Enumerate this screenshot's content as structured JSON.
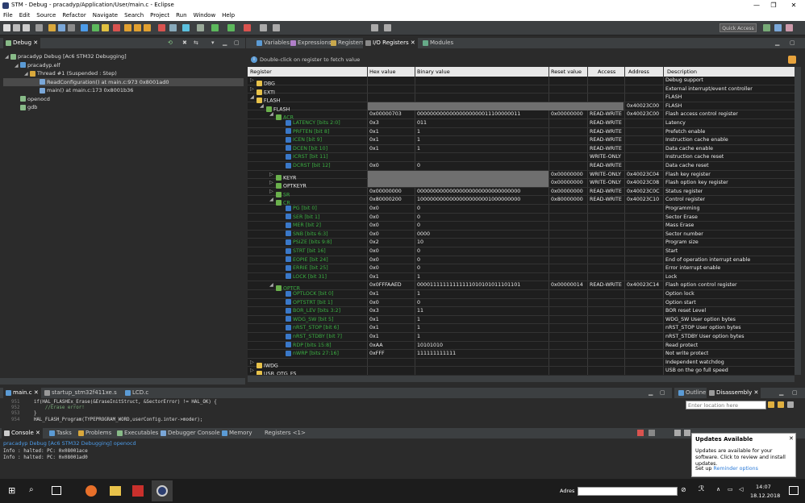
{
  "window": {
    "title": "STM - Debug - pracadyp/Application/User/main.c - Eclipse",
    "minimize": "—",
    "maximize": "❐",
    "close": "✕"
  },
  "menu": [
    "File",
    "Edit",
    "Source",
    "Refactor",
    "Navigate",
    "Search",
    "Project",
    "Run",
    "Window",
    "Help"
  ],
  "toolbar": {
    "quick_access": "Quick Access"
  },
  "debug": {
    "tab": "Debug",
    "tree": [
      {
        "label": "pracadyp Debug [Ac6 STM32 Debugging]",
        "indent": 0
      },
      {
        "label": "pracadyp.elf",
        "indent": 1
      },
      {
        "label": "Thread #1 (Suspended : Step)",
        "indent": 2
      },
      {
        "label": "ReadConfiguration() at main.c:973 0x8001ad0",
        "indent": 3
      },
      {
        "label": "main() at main.c:173 0x8001b36",
        "indent": 3
      },
      {
        "label": "openocd",
        "indent": 1
      },
      {
        "label": "gdb",
        "indent": 1
      }
    ]
  },
  "io": {
    "tabs": [
      "Variables",
      "Expressions",
      "Registers",
      "I/O Registers",
      "Modules"
    ],
    "hint": "Double-click on register to fetch value",
    "columns": [
      "Register",
      "Hex value",
      "Binary value",
      "Reset value",
      "Access",
      "Address",
      "Description"
    ],
    "rows": [
      {
        "lvl": 0,
        "tw": "▷",
        "name": "DBG",
        "hex": "",
        "bin": "",
        "reset": "",
        "access": "",
        "addr": "",
        "desc": "Debug support",
        "kind": "folder"
      },
      {
        "lvl": 0,
        "tw": "▷",
        "name": "EXTI",
        "hex": "",
        "bin": "",
        "reset": "",
        "access": "",
        "addr": "",
        "desc": "External interrupt/event controller",
        "kind": "folder"
      },
      {
        "lvl": 0,
        "tw": "◢",
        "name": "FLASH",
        "hex": "",
        "bin": "",
        "reset": "",
        "access": "",
        "addr": "",
        "desc": "FLASH",
        "kind": "folder"
      },
      {
        "lvl": 1,
        "tw": "◢",
        "name": "FLASH",
        "hex": "",
        "bin": "",
        "reset": "",
        "access": "",
        "addr": "0x40023C00",
        "desc": "FLASH",
        "kind": "periph",
        "gray": true
      },
      {
        "lvl": 2,
        "tw": "◢",
        "name": "ACR",
        "hex": "0x00000703",
        "bin": "00000000000000000000011100000011",
        "reset": "0x00000000",
        "access": "READ-WRITE",
        "addr": "0x40023C00",
        "desc": "Flash access control register",
        "kind": "reg",
        "green": true
      },
      {
        "lvl": 3,
        "tw": "",
        "name": "LATENCY [bits 2:0]",
        "hex": "0x3",
        "bin": "011",
        "reset": "",
        "access": "READ-WRITE",
        "addr": "",
        "desc": "Latency",
        "kind": "field"
      },
      {
        "lvl": 3,
        "tw": "",
        "name": "PRFTEN [bit 8]",
        "hex": "0x1",
        "bin": "1",
        "reset": "",
        "access": "READ-WRITE",
        "addr": "",
        "desc": "Prefetch enable",
        "kind": "field"
      },
      {
        "lvl": 3,
        "tw": "",
        "name": "ICEN [bit 9]",
        "hex": "0x1",
        "bin": "1",
        "reset": "",
        "access": "READ-WRITE",
        "addr": "",
        "desc": "Instruction cache enable",
        "kind": "field"
      },
      {
        "lvl": 3,
        "tw": "",
        "name": "DCEN [bit 10]",
        "hex": "0x1",
        "bin": "1",
        "reset": "",
        "access": "READ-WRITE",
        "addr": "",
        "desc": "Data cache enable",
        "kind": "field"
      },
      {
        "lvl": 3,
        "tw": "",
        "name": "ICRST [bit 11]",
        "hex": "",
        "bin": "",
        "reset": "",
        "access": "WRITE-ONLY",
        "addr": "",
        "desc": "Instruction cache reset",
        "kind": "field"
      },
      {
        "lvl": 3,
        "tw": "",
        "name": "DCRST [bit 12]",
        "hex": "0x0",
        "bin": "0",
        "reset": "",
        "access": "READ-WRITE",
        "addr": "",
        "desc": "Data cache reset",
        "kind": "field"
      },
      {
        "lvl": 2,
        "tw": "▷",
        "name": "KEYR",
        "hex": "",
        "bin": "",
        "reset": "0x00000000",
        "access": "WRITE-ONLY",
        "addr": "0x40023C04",
        "desc": "Flash key register",
        "kind": "reg",
        "gray": true
      },
      {
        "lvl": 2,
        "tw": "▷",
        "name": "OPTKEYR",
        "hex": "",
        "bin": "",
        "reset": "0x00000000",
        "access": "WRITE-ONLY",
        "addr": "0x40023C08",
        "desc": "Flash option key register",
        "kind": "reg",
        "gray": true
      },
      {
        "lvl": 2,
        "tw": "▷",
        "name": "SR",
        "hex": "0x00000000",
        "bin": "00000000000000000000000000000000",
        "reset": "0x00000000",
        "access": "READ-WRITE",
        "addr": "0x40023C0C",
        "desc": "Status register",
        "kind": "reg",
        "green": true
      },
      {
        "lvl": 2,
        "tw": "◢",
        "name": "CR",
        "hex": "0x80000200",
        "bin": "10000000000000000000001000000000",
        "reset": "0x80000000",
        "access": "READ-WRITE",
        "addr": "0x40023C10",
        "desc": "Control register",
        "kind": "reg",
        "green": true
      },
      {
        "lvl": 3,
        "tw": "",
        "name": "PG [bit 0]",
        "hex": "0x0",
        "bin": "0",
        "reset": "",
        "access": "",
        "addr": "",
        "desc": "Programming",
        "kind": "field"
      },
      {
        "lvl": 3,
        "tw": "",
        "name": "SER [bit 1]",
        "hex": "0x0",
        "bin": "0",
        "reset": "",
        "access": "",
        "addr": "",
        "desc": "Sector Erase",
        "kind": "field"
      },
      {
        "lvl": 3,
        "tw": "",
        "name": "MER [bit 2]",
        "hex": "0x0",
        "bin": "0",
        "reset": "",
        "access": "",
        "addr": "",
        "desc": "Mass Erase",
        "kind": "field"
      },
      {
        "lvl": 3,
        "tw": "",
        "name": "SNB [bits 6:3]",
        "hex": "0x0",
        "bin": "0000",
        "reset": "",
        "access": "",
        "addr": "",
        "desc": "Sector number",
        "kind": "field"
      },
      {
        "lvl": 3,
        "tw": "",
        "name": "PSIZE [bits 9:8]",
        "hex": "0x2",
        "bin": "10",
        "reset": "",
        "access": "",
        "addr": "",
        "desc": "Program size",
        "kind": "field"
      },
      {
        "lvl": 3,
        "tw": "",
        "name": "STRT [bit 16]",
        "hex": "0x0",
        "bin": "0",
        "reset": "",
        "access": "",
        "addr": "",
        "desc": "Start",
        "kind": "field"
      },
      {
        "lvl": 3,
        "tw": "",
        "name": "EOPIE [bit 24]",
        "hex": "0x0",
        "bin": "0",
        "reset": "",
        "access": "",
        "addr": "",
        "desc": "End of operation interrupt enable",
        "kind": "field"
      },
      {
        "lvl": 3,
        "tw": "",
        "name": "ERRIE [bit 25]",
        "hex": "0x0",
        "bin": "0",
        "reset": "",
        "access": "",
        "addr": "",
        "desc": "Error interrupt enable",
        "kind": "field"
      },
      {
        "lvl": 3,
        "tw": "",
        "name": "LOCK [bit 31]",
        "hex": "0x1",
        "bin": "1",
        "reset": "",
        "access": "",
        "addr": "",
        "desc": "Lock",
        "kind": "field"
      },
      {
        "lvl": 2,
        "tw": "◢",
        "name": "OPTCR",
        "hex": "0x0FFFAAED",
        "bin": "00001111111111111010101011101101",
        "reset": "0x00000014",
        "access": "READ-WRITE",
        "addr": "0x40023C14",
        "desc": "Flash option control register",
        "kind": "reg",
        "green": true
      },
      {
        "lvl": 3,
        "tw": "",
        "name": "OPTLOCK [bit 0]",
        "hex": "0x1",
        "bin": "1",
        "reset": "",
        "access": "",
        "addr": "",
        "desc": "Option lock",
        "kind": "field"
      },
      {
        "lvl": 3,
        "tw": "",
        "name": "OPTSTRT [bit 1]",
        "hex": "0x0",
        "bin": "0",
        "reset": "",
        "access": "",
        "addr": "",
        "desc": "Option start",
        "kind": "field"
      },
      {
        "lvl": 3,
        "tw": "",
        "name": "BOR_LEV [bits 3:2]",
        "hex": "0x3",
        "bin": "11",
        "reset": "",
        "access": "",
        "addr": "",
        "desc": "BOR reset Level",
        "kind": "field"
      },
      {
        "lvl": 3,
        "tw": "",
        "name": "WDG_SW [bit 5]",
        "hex": "0x1",
        "bin": "1",
        "reset": "",
        "access": "",
        "addr": "",
        "desc": "WDG_SW User option bytes",
        "kind": "field"
      },
      {
        "lvl": 3,
        "tw": "",
        "name": "nRST_STOP [bit 6]",
        "hex": "0x1",
        "bin": "1",
        "reset": "",
        "access": "",
        "addr": "",
        "desc": "nRST_STOP User option bytes",
        "kind": "field"
      },
      {
        "lvl": 3,
        "tw": "",
        "name": "nRST_STDBY [bit 7]",
        "hex": "0x1",
        "bin": "1",
        "reset": "",
        "access": "",
        "addr": "",
        "desc": "nRST_STDBY User option bytes",
        "kind": "field"
      },
      {
        "lvl": 3,
        "tw": "",
        "name": "RDP [bits 15:8]",
        "hex": "0xAA",
        "bin": "10101010",
        "reset": "",
        "access": "",
        "addr": "",
        "desc": "Read protect",
        "kind": "field"
      },
      {
        "lvl": 3,
        "tw": "",
        "name": "nWRP [bits 27:16]",
        "hex": "0xFFF",
        "bin": "111111111111",
        "reset": "",
        "access": "",
        "addr": "",
        "desc": "Not write protect",
        "kind": "field"
      },
      {
        "lvl": 0,
        "tw": "▷",
        "name": "IWDG",
        "hex": "",
        "bin": "",
        "reset": "",
        "access": "",
        "addr": "",
        "desc": "Independent watchdog",
        "kind": "folder"
      },
      {
        "lvl": 0,
        "tw": "▷",
        "name": "USB_OTG_FS",
        "hex": "",
        "bin": "",
        "reset": "",
        "access": "",
        "addr": "",
        "desc": "USB on the go full speed",
        "kind": "folder"
      }
    ]
  },
  "editor": {
    "tabs": [
      "main.c",
      "startup_stm32f411xe.s",
      "LCD.c"
    ],
    "lines": [
      {
        "n": "951",
        "t": "    if(HAL_FLASHEx_Erase(&EraseInitStruct, &SectorError) != HAL_OK) {"
      },
      {
        "n": "952",
        "t": "        //Erase error!"
      },
      {
        "n": "953",
        "t": "    }"
      },
      {
        "n": "954",
        "t": "    HAL_FLASH_Program(TYPEPROGRAM_WORD,userConfig.inter->moder);"
      }
    ]
  },
  "outline": {
    "tabs": [
      "Outline",
      "Disassembly"
    ],
    "location_placeholder": "Enter location here"
  },
  "console": {
    "tabs": [
      "Console",
      "Tasks",
      "Problems",
      "Executables",
      "Debugger Console",
      "Memory",
      "Registers <1>"
    ],
    "title": "pracadyp Debug [Ac6 STM32 Debugging] openocd",
    "lines": [
      "Info : halted: PC: 0x08001ace",
      "Info : halted: PC: 0x08001ad0"
    ]
  },
  "notification": {
    "title": "Updates Available",
    "body": "Updates are available for your software. Click to review and install updates.",
    "setup": "Set up",
    "link": "Reminder options"
  },
  "taskbar": {
    "address_label": "Adres",
    "time": "14:07",
    "date": "18.12.2018"
  }
}
